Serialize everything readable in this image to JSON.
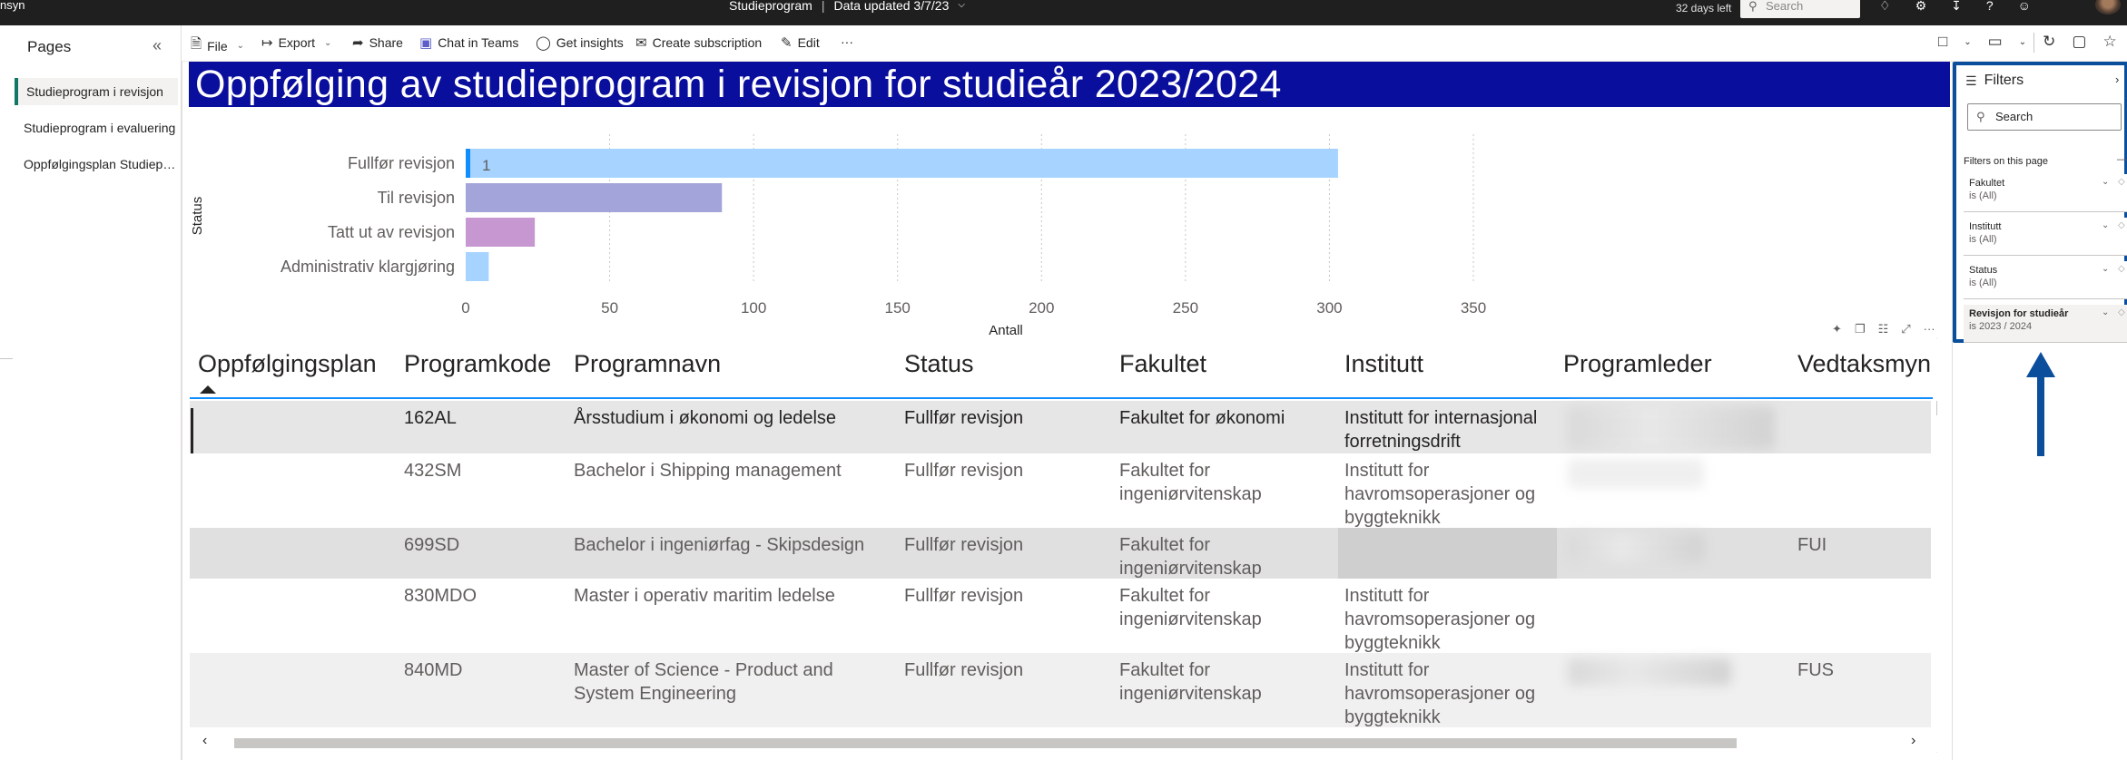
{
  "topbar": {
    "brand": "nsyn",
    "report_name": "Studieprogram",
    "separator": "|",
    "data_updated": "Data updated 3/7/23",
    "trial": "32 days left",
    "search_placeholder": "Search"
  },
  "pages": {
    "title": "Pages",
    "items": [
      {
        "label": "Studieprogram i revisjon"
      },
      {
        "label": "Studieprogram i evaluering"
      },
      {
        "label": "Oppfølgingsplan Studieprogram"
      }
    ]
  },
  "toolbar": {
    "file": "File",
    "export": "Export",
    "share": "Share",
    "chat": "Chat in Teams",
    "insights": "Get insights",
    "subscription": "Create subscription",
    "edit": "Edit",
    "more": "···"
  },
  "report": {
    "title": "Oppfølging av studieprogram i revisjon for studieår 2023/2024"
  },
  "chart_data": {
    "type": "bar",
    "orientation": "horizontal",
    "categories": [
      "Fullfør revisjon",
      "Til revisjon",
      "Tatt ut av revisjon",
      "Administrativ klargjøring"
    ],
    "values": [
      303,
      89,
      24,
      8
    ],
    "bar_colors": [
      "#a6d3ff",
      "#a3a4d9",
      "#c697d0",
      "#a6d3ff"
    ],
    "highlight_value_label": "1",
    "xlabel": "Antall",
    "ylabel": "Status",
    "xlim": [
      0,
      350
    ],
    "xticks": [
      0,
      50,
      100,
      150,
      200,
      250,
      300,
      350
    ],
    "grid": true
  },
  "table": {
    "columns": [
      "Oppfølgingsplan",
      "Programkode",
      "Programnavn",
      "Status",
      "Fakultet",
      "Institutt",
      "Programleder",
      "Vedtaksmyn"
    ],
    "rows": [
      {
        "kode": "162AL",
        "navn": [
          "Årsstudium i økonomi og ledelse"
        ],
        "status": "Fullfør revisjon",
        "fakultet": [
          "Fakultet for økonomi"
        ],
        "institutt": [
          "Institutt for internasjonal",
          "forretningsdrift"
        ],
        "vedtak": ""
      },
      {
        "kode": "432SM",
        "navn": [
          "Bachelor i Shipping management"
        ],
        "status": "Fullfør revisjon",
        "fakultet": [
          "Fakultet for",
          "ingeniørvitenskap"
        ],
        "institutt": [
          "Institutt for",
          "havromsoperasjoner og",
          "byggteknikk"
        ],
        "vedtak": ""
      },
      {
        "kode": "699SD",
        "navn": [
          "Bachelor i ingeniørfag - Skipsdesign"
        ],
        "status": "Fullfør revisjon",
        "fakultet": [
          "Fakultet for",
          "ingeniørvitenskap"
        ],
        "institutt": [],
        "vedtak": "FUI"
      },
      {
        "kode": "830MDO",
        "navn": [
          "Master i operativ maritim ledelse"
        ],
        "status": "Fullfør revisjon",
        "fakultet": [
          "Fakultet for",
          "ingeniørvitenskap"
        ],
        "institutt": [
          "Institutt for",
          "havromsoperasjoner og",
          "byggteknikk"
        ],
        "vedtak": ""
      },
      {
        "kode": "840MD",
        "navn": [
          "Master of Science - Product and",
          "System Engineering"
        ],
        "status": "Fullfør revisjon",
        "fakultet": [
          "Fakultet for",
          "ingeniørvitenskap"
        ],
        "institutt": [
          "Institutt for",
          "havromsoperasjoner og",
          "byggteknikk"
        ],
        "vedtak": "FUS"
      }
    ]
  },
  "filters": {
    "title": "Filters",
    "search_placeholder": "Search",
    "section": "Filters on this page",
    "cards": [
      {
        "name": "Fakultet",
        "value": "is (All)"
      },
      {
        "name": "Institutt",
        "value": "is (All)"
      },
      {
        "name": "Status",
        "value": "is (All)"
      },
      {
        "name": "Revisjon for studieår",
        "value": "is 2023 / 2024"
      }
    ]
  },
  "colors": {
    "banner": "#0a0e9c",
    "annotation": "#0b4e9c",
    "active_page": "#117865"
  }
}
